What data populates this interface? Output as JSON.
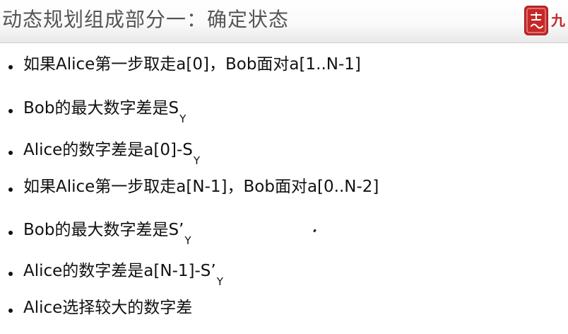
{
  "slide": {
    "title": "动态规划组成部分一：确定状态",
    "logo": {
      "seal_icon": "red-seal-logo-icon",
      "char": "九"
    },
    "bullets": [
      {
        "text": "如果Alice第一步取走a[0]，Bob面对a[1..N-1]",
        "sub": ""
      },
      {
        "text": "Bob的最大数字差是S",
        "sub": "Y"
      },
      {
        "text": "Alice的数字差是a[0]-S",
        "sub": "Y"
      },
      {
        "text": "如果Alice第一步取走a[N-1]，Bob面对a[0..N-2]",
        "sub": ""
      },
      {
        "text": "Bob的最大数字差是S’",
        "sub": "Y"
      },
      {
        "text": "Alice的数字差是a[N-1]-S’",
        "sub": "Y"
      },
      {
        "text": "Alice选择较大的数字差",
        "sub": ""
      }
    ]
  },
  "colors": {
    "title_text": "#555555",
    "body_text": "#111111",
    "logo_red": "#c62828",
    "header_gradient_end": "#e8e8e8"
  }
}
